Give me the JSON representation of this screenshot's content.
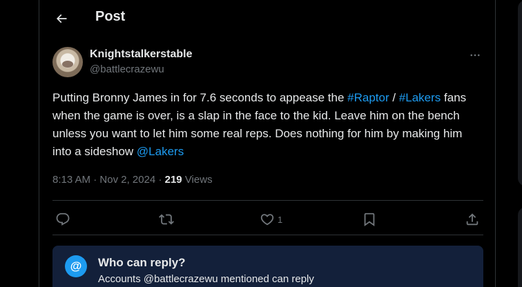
{
  "header": {
    "title": "Post"
  },
  "tweet": {
    "display_name": "Knightstalkerstable",
    "handle": "@battlecrazewu",
    "text_segments": [
      {
        "text": "Putting Bronny James in for 7.6 seconds to appease the ",
        "link": false
      },
      {
        "text": "#Raptor",
        "link": true
      },
      {
        "text": " / ",
        "link": false
      },
      {
        "text": "#Lakers",
        "link": true
      },
      {
        "text": " fans when the game is over, is a slap in the face to the kid. Leave him on the bench unless you want to let him some real reps. Does nothing for him by making him into a sideshow ",
        "link": false
      },
      {
        "text": "@Lakers",
        "link": true
      }
    ],
    "time": "8:13 AM",
    "date": "Nov 2, 2024",
    "views_count": "219",
    "views_label": "Views"
  },
  "actions": {
    "reply_icon": "reply-icon",
    "retweet_icon": "retweet-icon",
    "like_icon": "heart-icon",
    "like_count": "1",
    "bookmark_icon": "bookmark-icon",
    "share_icon": "share-icon"
  },
  "reply_settings": {
    "icon": "@",
    "title": "Who can reply?",
    "subtitle": "Accounts @battlecrazewu mentioned can reply"
  },
  "colors": {
    "background": "#000000",
    "text": "#e7e9ea",
    "muted": "#71767b",
    "link": "#1d9bf0",
    "divider": "#2f3336",
    "reply_box": "#13203a"
  }
}
